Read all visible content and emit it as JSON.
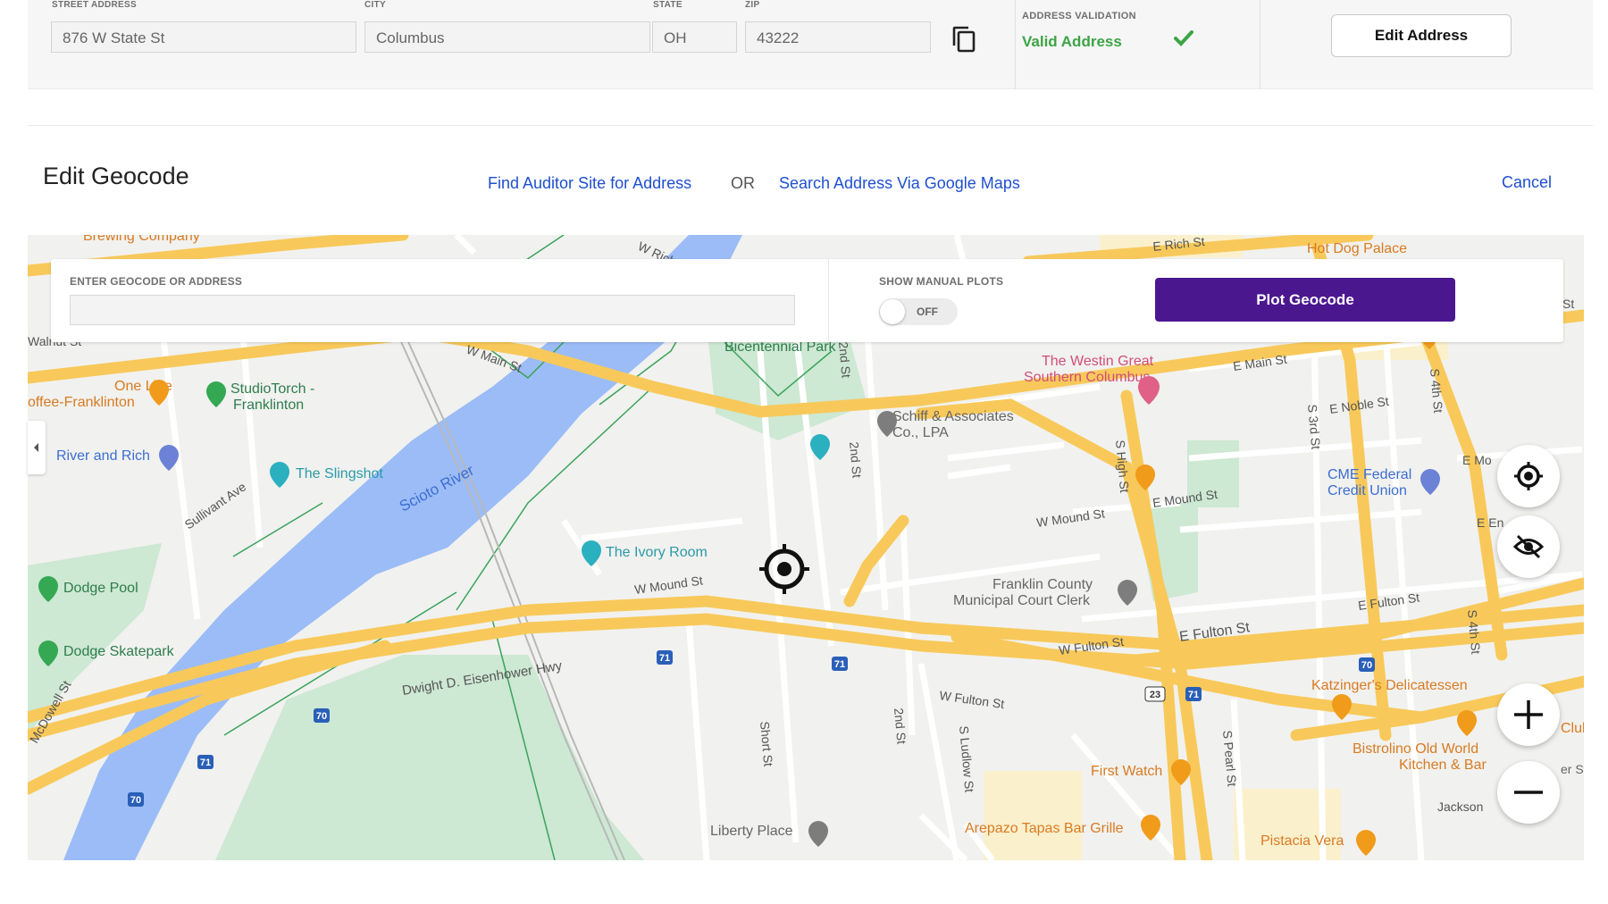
{
  "address": {
    "street_label": "STREET ADDRESS",
    "street_value": "876 W State St",
    "city_label": "CITY",
    "city_value": "Columbus",
    "state_label": "STATE",
    "state_value": "OH",
    "zip_label": "ZIP",
    "zip_value": "43222",
    "validation_label": "ADDRESS VALIDATION",
    "validation_status": "Valid Address",
    "edit_button": "Edit Address"
  },
  "geocode": {
    "title": "Edit Geocode",
    "find_auditor_link": "Find Auditor Site for Address",
    "or_text": "OR",
    "google_maps_link": "Search Address Via Google Maps",
    "cancel_link": "Cancel"
  },
  "panel": {
    "input_label": "ENTER GEOCODE OR ADDRESS",
    "input_value": "",
    "manual_plots_label": "SHOW MANUAL PLOTS",
    "toggle_state": "OFF",
    "plot_button": "Plot Geocode"
  },
  "map": {
    "streets": {
      "w_main": "W Main St",
      "e_main": "E Main St",
      "e_rich": "E Rich St",
      "w_rich": "W Rich",
      "second_st": "2nd St",
      "second_st_2": "2nd St",
      "second_st_3": "2nd St",
      "s_high": "S High St",
      "s_third": "S 3rd St",
      "s_fourth": "S 4th St",
      "s_fourth_2": "S 4th St",
      "e_noble": "E Noble St",
      "e_mound": "E Mound St",
      "w_mound": "W Mound St",
      "w_mound_2": "W Mound St",
      "e_fulton": "E Fulton St",
      "e_fulton_2": "E Fulton St",
      "w_fulton": "W Fulton St",
      "w_fulton_2": "W Fulton St",
      "eisenhower": "Dwight D. Eisenhower Hwy",
      "short_st": "Short St",
      "s_ludlow": "S Ludlow St",
      "s_pearl": "S Pearl St",
      "sullivant": "Sullivant Ave",
      "mcdowell": "McDowell St",
      "walnut": "Walnut St",
      "jackson": "Jackson",
      "e_mo": "E Mo",
      "e_en": "E En"
    },
    "places": {
      "river": "Scioto River",
      "bicentennial": "Bicentennial Park",
      "westin_1": "The Westin Great",
      "westin_2": "Southern Columbus",
      "schiff_1": "Schiff & Associates",
      "schiff_2": "Co., LPA",
      "cme_1": "CME Federal",
      "cme_2": "Credit Union",
      "franklin_1": "Franklin County",
      "franklin_2": "Municipal Court Clerk",
      "katzinger": "Katzinger's Delicatessen",
      "bistrolino_1": "Bistrolino Old World",
      "bistrolino_2": "Kitchen & Bar",
      "first_watch": "First Watch",
      "arepazo": "Arepazo Tapas Bar Grille",
      "pistacia": "Pistacia Vera",
      "liberty": "Liberty Place",
      "ivory": "The Ivory Room",
      "slingshot": "The Slingshot",
      "studiotorch_1": "StudioTorch -",
      "studiotorch_2": "Franklinton",
      "one_line_1": "One Line",
      "one_line_2": "offee-Franklinton",
      "river_rich": "River and Rich",
      "dodge_pool": "Dodge Pool",
      "dodge_skate": "Dodge Skatepark",
      "hot_dog": "Hot Dog Palace",
      "brewing": "Brewing Company",
      "club": "Club",
      "er_st": "er St",
      "st": "St"
    },
    "shields": {
      "i71": "71",
      "i70": "70",
      "us23": "23"
    }
  },
  "colors": {
    "accent": "#4b178f",
    "link": "#1f4fcf",
    "valid": "#3da446",
    "road": "#f8c95a",
    "water": "#9bbcf7",
    "park": "#cde8d3",
    "poi_food": "#f09b1a",
    "poi_green": "#34a853",
    "poi_teal": "#2bb0bf",
    "poi_pink": "#e06087"
  }
}
